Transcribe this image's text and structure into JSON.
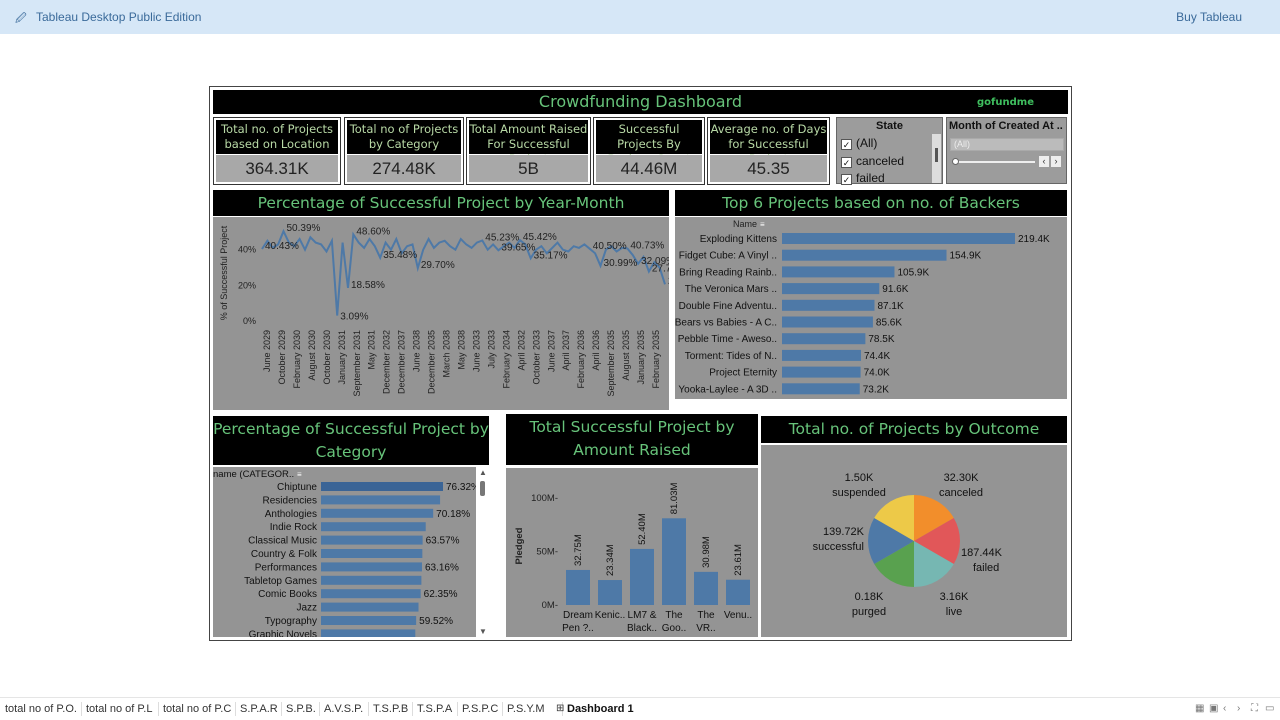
{
  "app": {
    "title": "Tableau Desktop Public Edition",
    "buy": "Buy Tableau"
  },
  "dashboard": {
    "title": "Crowdfunding Dashboard",
    "logo": "gofundme"
  },
  "kpis": [
    {
      "label": "Total no. of Projects based on Location",
      "value": "364.31K"
    },
    {
      "label": "Total no of Projects by Category",
      "value": "274.48K"
    },
    {
      "label": "Total Amount Raised For Successful Project",
      "value": "5B"
    },
    {
      "label": "Successful Projects By Backers Count",
      "value": "44.46M"
    },
    {
      "label": "Average no. of Days for Successful Project",
      "value": "45.35"
    }
  ],
  "filters": {
    "state": {
      "title": "State",
      "items": [
        {
          "label": "(All)",
          "checked": true
        },
        {
          "label": "canceled",
          "checked": true
        },
        {
          "label": "failed",
          "checked": true
        }
      ]
    },
    "month": {
      "title": "Month of Created At ..",
      "value": "(All)"
    }
  },
  "panels": {
    "year_month": "Percentage of Successful Project by Year-Month",
    "top6": "Top 6 Projects based on no. of Backers",
    "by_category": "Percentage of Successful Project by Category",
    "amount_raised": "Total Successful Project by Amount Raised",
    "outcome": "Total no. of Projects by Outcome"
  },
  "chart_data": [
    {
      "type": "line",
      "title": "Percentage of Successful Project by Year-Month",
      "ylabel": "% of Successful Project",
      "yticks": [
        "0%",
        "20%",
        "40%"
      ],
      "ylim": [
        0,
        55
      ],
      "xticks": [
        "June 2029",
        "October 2029",
        "February 2030",
        "August 2030",
        "October 2030",
        "January 2031",
        "September 2031",
        "May 2031",
        "December 2032",
        "December 2037",
        "June 2038",
        "December 2035",
        "March 2038",
        "May 2038",
        "June 2033",
        "July 2033",
        "February 2034",
        "April 2032",
        "October 2033",
        "June 2037",
        "April 2037",
        "February 2036",
        "April 2036",
        "September 2035",
        "August 2035",
        "January 2035",
        "February 2035"
      ],
      "values": [
        40.4,
        45,
        41,
        43,
        50.4,
        44,
        42,
        46,
        40,
        47,
        44,
        43,
        39,
        45,
        3.1,
        44,
        18.6,
        48.6,
        44,
        41,
        46,
        42,
        35.5,
        44,
        40,
        46,
        38,
        42,
        43,
        29.7,
        40,
        46,
        41,
        44,
        45,
        42,
        40,
        46,
        43,
        41,
        44,
        45.2,
        40,
        43,
        39.7,
        42,
        44,
        41,
        45.4,
        43,
        35.2,
        40,
        42,
        38,
        41,
        44,
        40,
        39,
        42,
        41,
        43,
        40.5,
        38,
        31,
        40,
        42,
        39,
        41,
        40.7,
        37,
        32.1,
        36,
        27.8,
        33,
        30,
        20.6
      ],
      "labels": [
        {
          "i": 0,
          "v": 40.43,
          "text": "40.43%"
        },
        {
          "i": 4,
          "v": 50.39,
          "text": "50.39%"
        },
        {
          "i": 14,
          "v": 3.09,
          "text": "3.09%"
        },
        {
          "i": 16,
          "v": 18.58,
          "text": "18.58%"
        },
        {
          "i": 17,
          "v": 48.6,
          "text": "48.60%"
        },
        {
          "i": 22,
          "v": 35.48,
          "text": "35.48%"
        },
        {
          "i": 29,
          "v": 29.7,
          "text": "29.70%"
        },
        {
          "i": 41,
          "v": 45.23,
          "text": "45.23%"
        },
        {
          "i": 44,
          "v": 39.65,
          "text": "39.65%"
        },
        {
          "i": 48,
          "v": 45.42,
          "text": "45.42%"
        },
        {
          "i": 50,
          "v": 35.17,
          "text": "35.17%"
        },
        {
          "i": 61,
          "v": 40.5,
          "text": "40.50%"
        },
        {
          "i": 63,
          "v": 30.99,
          "text": "30.99%"
        },
        {
          "i": 68,
          "v": 40.73,
          "text": "40.73%"
        },
        {
          "i": 70,
          "v": 32.09,
          "text": "32.09%"
        },
        {
          "i": 72,
          "v": 27.79,
          "text": "27.79%"
        },
        {
          "i": 75,
          "v": 20.64,
          "text": "20.64%"
        }
      ]
    },
    {
      "type": "bar",
      "title": "Top 6 Projects based on no. of Backers",
      "header": "Name",
      "categories": [
        "Exploding Kittens",
        "Fidget Cube: A Vinyl ..",
        "Bring Reading Rainb..",
        "The Veronica Mars ..",
        "Double Fine Adventu..",
        "Bears vs Babies - A C..",
        "Pebble Time - Aweso..",
        "Torment: Tides of N..",
        "Project Eternity",
        "Yooka-Laylee - A 3D .."
      ],
      "values": [
        219.4,
        154.9,
        105.9,
        91.6,
        87.1,
        85.6,
        78.5,
        74.4,
        74.0,
        73.2
      ],
      "labels": [
        "219.4K",
        "154.9K",
        "105.9K",
        "91.6K",
        "87.1K",
        "85.6K",
        "78.5K",
        "74.4K",
        "74.0K",
        "73.2K"
      ]
    },
    {
      "type": "bar",
      "title": "Percentage of Successful Project by Category",
      "header": "name (CATEGOR..",
      "categories": [
        "Chiptune",
        "Residencies",
        "Anthologies",
        "Indie Rock",
        "Classical Music",
        "Country & Folk",
        "Performances",
        "Tabletop Games",
        "Comic Books",
        "Jazz",
        "Typography",
        "Graphic Novels"
      ],
      "values": [
        76.32,
        74.5,
        70.18,
        65.5,
        63.57,
        63.4,
        63.16,
        62.8,
        62.35,
        61.0,
        59.52,
        59.0
      ],
      "labels": [
        "76.32%",
        "",
        "70.18%",
        "",
        "63.57%",
        "",
        "63.16%",
        "",
        "62.35%",
        "",
        "59.52%",
        ""
      ]
    },
    {
      "type": "bar",
      "title": "Total Successful Project by Amount Raised",
      "ylabel": "Pledged",
      "yticks": [
        "0M",
        "50M",
        "100M"
      ],
      "ylim": [
        0,
        100
      ],
      "categories": [
        [
          "Dream",
          "Pen ?.."
        ],
        [
          "Kenic.."
        ],
        [
          "LM7 &",
          "Black.."
        ],
        [
          "The",
          "Goo.."
        ],
        [
          "The",
          "VR.."
        ],
        [
          "Venu.."
        ]
      ],
      "values": [
        32.75,
        23.34,
        52.4,
        81.03,
        30.98,
        23.61
      ],
      "labels": [
        "32.75M",
        "23.34M",
        "52.40M",
        "81.03M",
        "30.98M",
        "23.61M"
      ]
    },
    {
      "type": "pie",
      "title": "Total no. of Projects by Outcome",
      "slices": [
        {
          "name": "canceled",
          "value": 32.3,
          "label": "32.30K",
          "color": "#f28e2b"
        },
        {
          "name": "failed",
          "value": 187.44,
          "label": "187.44K",
          "color": "#e15759"
        },
        {
          "name": "live",
          "value": 3.16,
          "label": "3.16K",
          "color": "#76b7b2"
        },
        {
          "name": "purged",
          "value": 0.18,
          "label": "0.18K",
          "color": "#59a14f"
        },
        {
          "name": "successful",
          "value": 139.72,
          "label": "139.72K",
          "color": "#4e79a7"
        },
        {
          "name": "suspended",
          "value": 1.5,
          "label": "1.50K",
          "color": "#edc948"
        }
      ]
    }
  ],
  "sheets": [
    "total no of P.O.",
    "total no of P.L",
    "total no of P.C",
    "S.P.A.R",
    "S.P.B.",
    "A.V.S.P.",
    "T.S.P.B",
    "T.S.P.A",
    "P.S.P.C",
    "P.S.Y.M",
    "Dashboard 1"
  ],
  "colors": {
    "bar": "#4e79a7",
    "bar_dark": "#3a6496",
    "title_green": "#67c37a",
    "panel_gray": "#949494"
  }
}
